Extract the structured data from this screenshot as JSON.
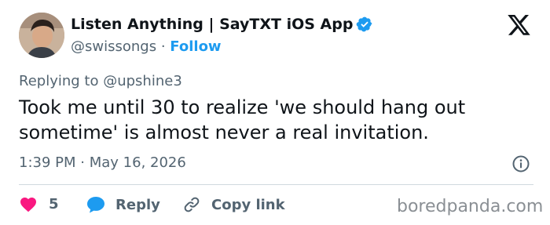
{
  "author": {
    "name": "Listen Anything | SayTXT iOS App",
    "handle": "@swissongs",
    "separator": "·",
    "follow_label": "Follow",
    "verified_icon": "verified-badge-icon",
    "avatar": "avatar"
  },
  "platform_icon": "x-logo-icon",
  "reply_context": {
    "prefix": "Replying to",
    "target": "@upshine3"
  },
  "tweet": {
    "text": "Took me until 30 to realize 'we should hang out sometime' is almost never a real invitation."
  },
  "meta": {
    "time": "1:39 PM",
    "separator": "·",
    "date": "May 16, 2026",
    "info_icon": "info-icon"
  },
  "actions": {
    "likes_count": "5",
    "reply_label": "Reply",
    "copy_link_label": "Copy link",
    "like_icon": "heart-icon",
    "reply_icon": "speech-bubble-icon",
    "link_icon": "link-icon"
  },
  "watermark": "boredpanda.com",
  "colors": {
    "accent": "#1d9bf0",
    "like": "#f91880",
    "text": "#0f1419",
    "muted": "#536471"
  }
}
